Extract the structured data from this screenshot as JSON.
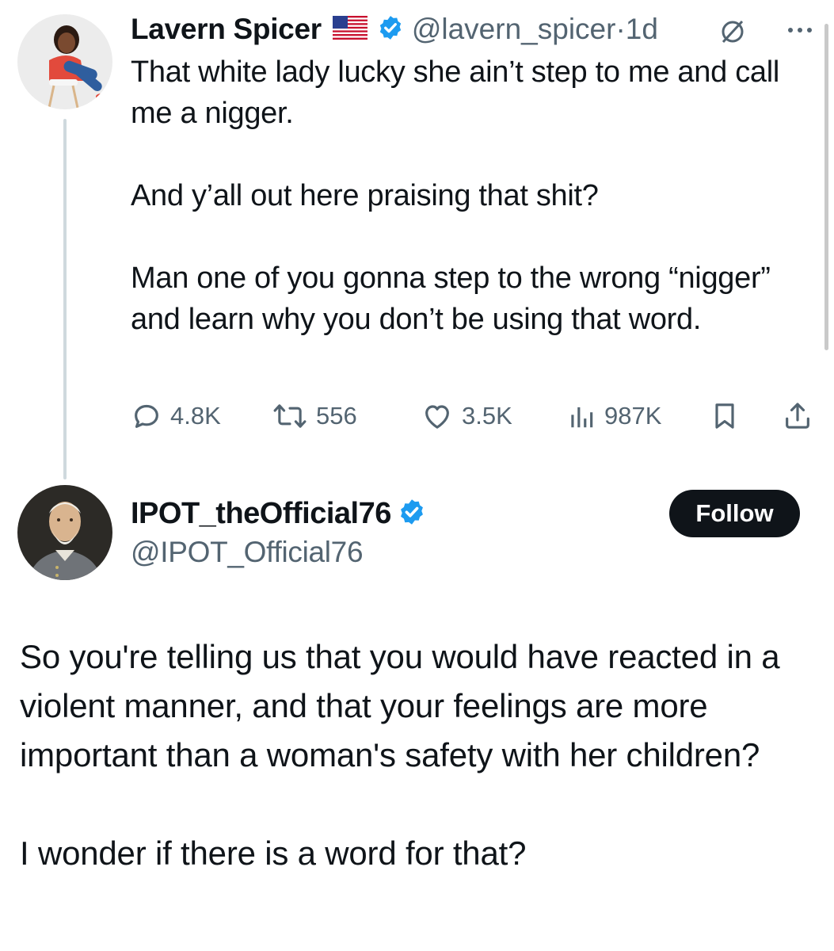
{
  "tweet": {
    "author_name": "Lavern Spicer",
    "author_handle": "@lavern_spicer",
    "separator": "·",
    "time": "1d",
    "paragraphs": [
      "That white lady lucky she ain’t step to me and call me a nigger.",
      "And y’all out here praising that shit?",
      "Man one of you gonna step to the wrong “nigger” and learn why you don’t be using that word."
    ],
    "metrics": {
      "replies": "4.8K",
      "reposts": "556",
      "likes": "3.5K",
      "views": "987K"
    }
  },
  "reply": {
    "author_name": "IPOT_theOfficial76",
    "author_handle": "@IPOT_Official76",
    "follow_label": "Follow",
    "paragraphs": [
      "So you're telling us that you would have reacted in a violent manner, and that your feelings are more important than a woman's safety with her children?",
      "I wonder if there is a word for that?"
    ]
  },
  "colors": {
    "text": "#0f1419",
    "muted": "#536471",
    "verified": "#1d9bf0",
    "follow_bg": "#0f1419",
    "thread_line": "#cfd9de"
  },
  "icons": [
    "us-flag-icon",
    "verified-badge-icon",
    "no-edit-icon",
    "more-icon",
    "reply-icon",
    "repost-icon",
    "like-icon",
    "views-icon",
    "bookmark-icon",
    "share-icon"
  ]
}
